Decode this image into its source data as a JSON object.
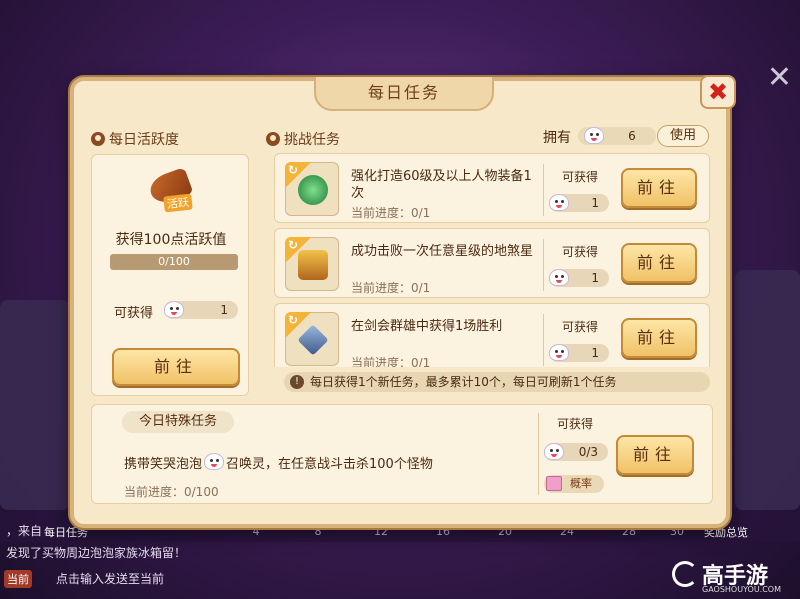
{
  "panel": {
    "title": "每日任务",
    "close_label": "✖"
  },
  "activity": {
    "heading": "每日活跃度",
    "icon_tag": "活跃",
    "goal": "获得100点活跃值",
    "progress_text": "0/100",
    "progress_fraction": 0.0,
    "reward_label": "可获得",
    "reward_count": "1",
    "go_label": "前往"
  },
  "challenge": {
    "heading": "挑战任务",
    "owned_label": "拥有",
    "owned_count": "6",
    "use_label": "使用",
    "tasks": [
      {
        "title": "强化打造60级及以上人物装备1次",
        "progress": "当前进度：0/1",
        "get_label": "可获得",
        "reward": "1",
        "go_label": "前往",
        "icon": "green-jade-icon"
      },
      {
        "title": "成功击败一次任意星级的地煞星",
        "progress": "当前进度：0/1",
        "get_label": "可获得",
        "reward": "1",
        "go_label": "前往",
        "icon": "treasure-chest-icon"
      },
      {
        "title": "在剑会群雄中获得1场胜利",
        "progress": "当前进度：0/1",
        "get_label": "可获得",
        "reward": "1",
        "go_label": "前往",
        "icon": "crossed-swords-icon"
      }
    ],
    "notice": "每日获得1个新任务，最多累计10个，每日可刷新1个任务"
  },
  "special": {
    "tab_label": "今日特殊任务",
    "desc_before": "携带笑哭泡泡",
    "desc_after": "召唤灵，在任意战斗击杀100个怪物",
    "progress": "当前进度：0/100",
    "get_label": "可获得",
    "reward": "0/3",
    "chance_label": "概率",
    "go_label": "前往"
  },
  "background": {
    "ticks": [
      "4",
      "8",
      "12",
      "16",
      "20",
      "24",
      "28",
      "30"
    ],
    "chat_lines": [
      "，来自",
      "发现了买物周边泡泡家族冰箱留！"
    ],
    "daily_task_btn": "每日任务",
    "reward_preview_btn": "奖励总览",
    "chat_tag": "当前",
    "chat_placeholder": "点击输入发送至当前"
  },
  "watermark": {
    "brand": "高手游",
    "site": "GAOSHOUYOU.COM"
  },
  "colors": {
    "panel_bg": "#f6e8c8",
    "button_gold": "#f0c267",
    "close_red": "#d3221b",
    "accent_orange": "#f4b43a"
  }
}
